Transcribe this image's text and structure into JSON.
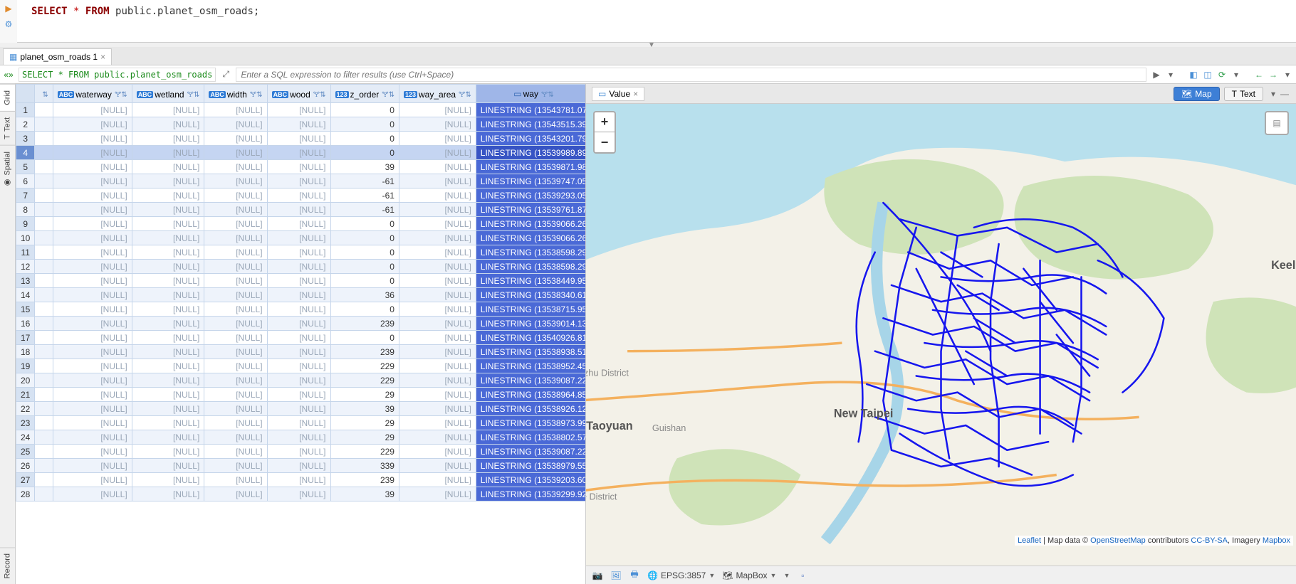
{
  "sql": {
    "select": "SELECT",
    "star": "*",
    "from": "FROM",
    "table": "public.planet_osm_roads",
    "semi": ";"
  },
  "tab": {
    "label": "planet_osm_roads 1"
  },
  "filter": {
    "chip": "SELECT * FROM public.planet_osm_roads",
    "placeholder": "Enter a SQL expression to filter results (use Ctrl+Space)"
  },
  "vtabs": {
    "grid": "Grid",
    "text": "Text",
    "spatial": "Spatial",
    "record": "Record"
  },
  "columns": {
    "waterway": "waterway",
    "wetland": "wetland",
    "width": "width",
    "wood": "wood",
    "z_order": "z_order",
    "way_area": "way_area",
    "way": "way"
  },
  "rows": [
    {
      "n": 1,
      "z_order": 0,
      "way": "LINESTRING (13543781.07"
    },
    {
      "n": 2,
      "z_order": 0,
      "way": "LINESTRING (13543515.39"
    },
    {
      "n": 3,
      "z_order": 0,
      "way": "LINESTRING (13543201.79"
    },
    {
      "n": 4,
      "z_order": 0,
      "way": "LINESTRING (13539989.89",
      "selected": true
    },
    {
      "n": 5,
      "z_order": 39,
      "way": "LINESTRING (13539871.98"
    },
    {
      "n": 6,
      "z_order": -61,
      "way": "LINESTRING (13539747.05"
    },
    {
      "n": 7,
      "z_order": -61,
      "way": "LINESTRING (13539293.05"
    },
    {
      "n": 8,
      "z_order": -61,
      "way": "LINESTRING (13539761.87"
    },
    {
      "n": 9,
      "z_order": 0,
      "way": "LINESTRING (13539066.26"
    },
    {
      "n": 10,
      "z_order": 0,
      "way": "LINESTRING (13539066.26"
    },
    {
      "n": 11,
      "z_order": 0,
      "way": "LINESTRING (13538598.29"
    },
    {
      "n": 12,
      "z_order": 0,
      "way": "LINESTRING (13538598.29"
    },
    {
      "n": 13,
      "z_order": 0,
      "way": "LINESTRING (13538449.95"
    },
    {
      "n": 14,
      "z_order": 36,
      "way": "LINESTRING (13538340.61"
    },
    {
      "n": 15,
      "z_order": 0,
      "way": "LINESTRING (13538715.95"
    },
    {
      "n": 16,
      "z_order": 239,
      "way": "LINESTRING (13539014.13"
    },
    {
      "n": 17,
      "z_order": 0,
      "way": "LINESTRING (13540926.81"
    },
    {
      "n": 18,
      "z_order": 239,
      "way": "LINESTRING (13538938.51"
    },
    {
      "n": 19,
      "z_order": 229,
      "way": "LINESTRING (13538952.45"
    },
    {
      "n": 20,
      "z_order": 229,
      "way": "LINESTRING (13539087.22"
    },
    {
      "n": 21,
      "z_order": 29,
      "way": "LINESTRING (13538964.85"
    },
    {
      "n": 22,
      "z_order": 39,
      "way": "LINESTRING (13538926.12"
    },
    {
      "n": 23,
      "z_order": 29,
      "way": "LINESTRING (13538973.99"
    },
    {
      "n": 24,
      "z_order": 29,
      "way": "LINESTRING (13538802.57"
    },
    {
      "n": 25,
      "z_order": 229,
      "way": "LINESTRING (13539087.22"
    },
    {
      "n": 26,
      "z_order": 339,
      "way": "LINESTRING (13538979.55"
    },
    {
      "n": 27,
      "z_order": 239,
      "way": "LINESTRING (13539203.60"
    },
    {
      "n": 28,
      "z_order": 39,
      "way": "LINESTRING (13539299.92"
    }
  ],
  "null_text": "[NULL]",
  "map_panel": {
    "value_tab": "Value",
    "map_btn": "Map",
    "text_btn": "Text",
    "zoom_in": "+",
    "zoom_out": "−",
    "attrib": {
      "leaflet": "Leaflet",
      "sep": " | Map data © ",
      "osm": "OpenStreetMap",
      "contrib": " contributors ",
      "cc": "CC-BY-SA",
      "imagery": ", Imagery ",
      "mapbox": "Mapbox"
    },
    "srs": "EPSG:3857",
    "tiles": "MapBox",
    "labels": {
      "keelung": "Keelung",
      "taoyuan": "Taoyuan",
      "newtaipei": "New Taipei",
      "luzhu": "Luzhu District",
      "bade": "Bade District",
      "guishan": "Guishan"
    }
  }
}
